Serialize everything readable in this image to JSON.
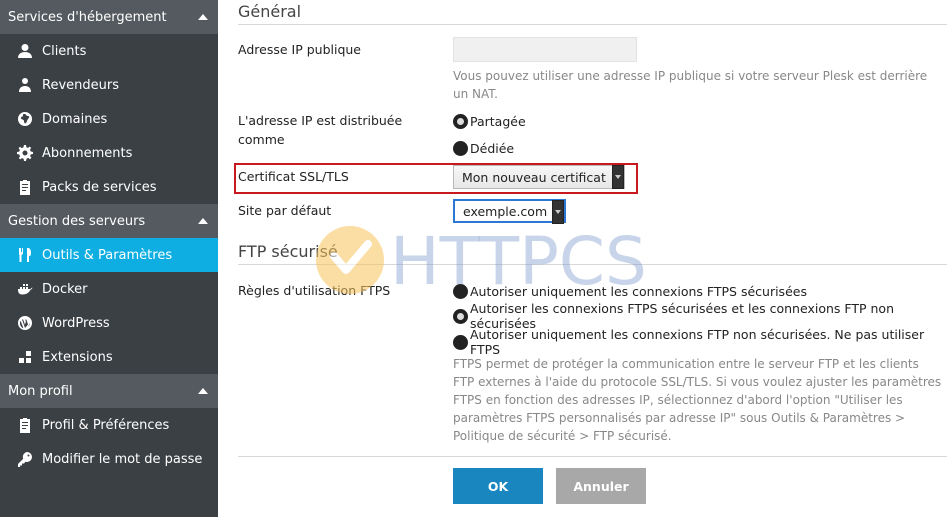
{
  "sidebar": {
    "sections": [
      {
        "title": "Services d'hébergement"
      },
      {
        "title": "Gestion des serveurs"
      },
      {
        "title": "Mon profil"
      }
    ],
    "items": [
      {
        "label": "Clients",
        "icon": "user-icon"
      },
      {
        "label": "Revendeurs",
        "icon": "reseller-icon"
      },
      {
        "label": "Domaines",
        "icon": "globe-icon"
      },
      {
        "label": "Abonnements",
        "icon": "gear-icon"
      },
      {
        "label": "Packs de services",
        "icon": "clipboard-icon"
      },
      {
        "label": "Outils & Paramètres",
        "icon": "tools-icon"
      },
      {
        "label": "Docker",
        "icon": "docker-icon"
      },
      {
        "label": "WordPress",
        "icon": "wordpress-icon"
      },
      {
        "label": "Extensions",
        "icon": "extensions-icon"
      },
      {
        "label": "Profil & Préférences",
        "icon": "profile-icon"
      },
      {
        "label": "Modifier le mot de passe",
        "icon": "key-icon"
      }
    ],
    "active_item": "Outils & Paramètres"
  },
  "general": {
    "title": "Général",
    "public_ip_label": "Adresse IP publique",
    "public_ip_value": "",
    "public_ip_hint": "Vous pouvez utiliser une adresse IP publique si votre serveur Plesk est derrière un NAT.",
    "distribution_label": "L'adresse IP est distribuée comme",
    "distribution_options": [
      "Partagée",
      "Dédiée"
    ],
    "distribution_selected": "Partagée",
    "ssl_label": "Certificat SSL/TLS",
    "ssl_value": "Mon nouveau certificat",
    "default_site_label": "Site par défaut",
    "default_site_value": "exemple.com"
  },
  "ftp": {
    "title": "FTP sécurisé",
    "rules_label": "Règles d'utilisation FTPS",
    "options": [
      "Autoriser uniquement les connexions FTPS sécurisées",
      "Autoriser les connexions FTPS sécurisées et les connexions FTP non sécurisées",
      "Autoriser uniquement les connexions FTP non sécurisées. Ne pas utiliser FTPS"
    ],
    "selected": "Autoriser les connexions FTPS sécurisées et les connexions FTP non sécurisées",
    "hint": "FTPS permet de protéger la communication entre le serveur FTP et les clients FTP externes à l'aide du protocole SSL/TLS. Si vous voulez ajuster les paramètres FTPS en fonction des adresses IP, sélectionnez d'abord l'option \"Utiliser les paramètres FTPS personnalisés par adresse IP\" sous Outils & Paramètres > Politique de sécurité > FTP sécurisé."
  },
  "buttons": {
    "ok": "OK",
    "cancel": "Annuler"
  },
  "watermark": {
    "text": "HTTPCS"
  },
  "colors": {
    "active": "#0faee2",
    "ok_button": "#1a86c0",
    "highlight": "#c8191f"
  }
}
